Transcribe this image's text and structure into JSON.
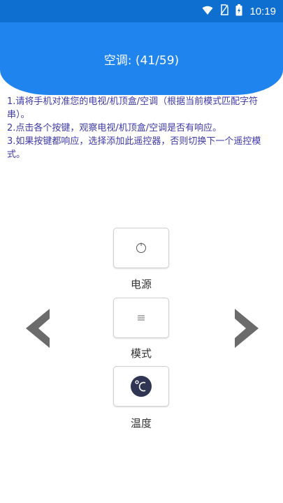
{
  "status_bar": {
    "time": "10:19",
    "icons": [
      "wifi-icon",
      "no-sim-icon",
      "battery-icon"
    ]
  },
  "header": {
    "title": "空调: (41/59)"
  },
  "instructions": [
    "1.请将手机对准您的电视/机顶盒/空调（根据当前模式匹配字符串）。",
    "2.点击各个按键，观察电视/机顶盒/空调是否有响应。",
    "3.如果按键都响应，选择添加此遥控器，否则切换下一个遥控模式。"
  ],
  "keys": [
    {
      "label": "电源",
      "icon": "power-icon"
    },
    {
      "label": "模式",
      "icon": "mode-icon"
    },
    {
      "label": "温度",
      "icon": "celsius-icon"
    }
  ],
  "nav": {
    "prev_icon": "chevron-left-icon",
    "next_icon": "chevron-right-icon"
  },
  "colors": {
    "status_bar": "#0f6fd0",
    "header": "#1f84ee",
    "instruction_text": "#3d3aa8",
    "arrow": "#6b6b6b",
    "temp_icon_fill": "#2f3552"
  }
}
